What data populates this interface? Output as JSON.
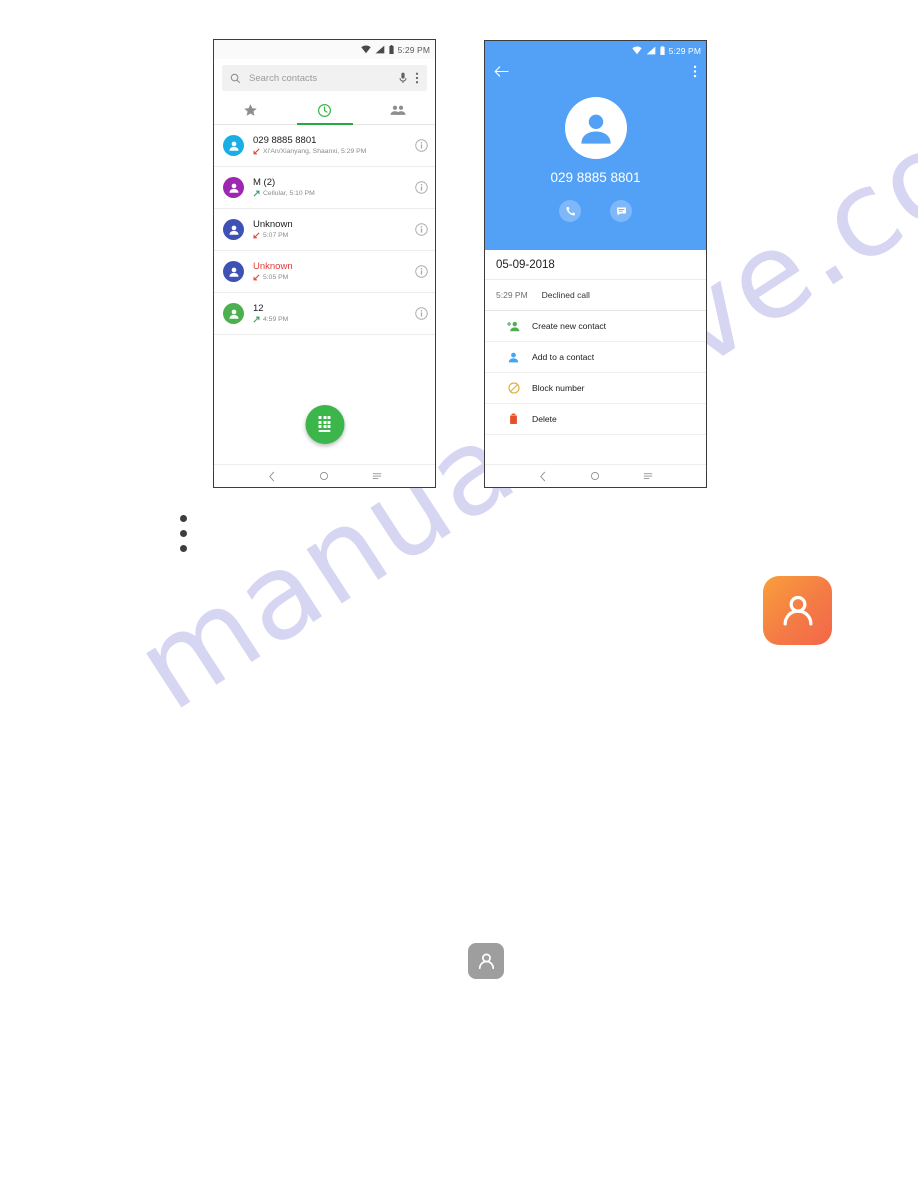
{
  "watermark": {
    "text": "manualshive.com"
  },
  "phone_left": {
    "status_bar": {
      "time": "5:29 PM",
      "icons": [
        "wifi-icon",
        "signal-icon",
        "battery-icon"
      ]
    },
    "search": {
      "placeholder": "Search contacts",
      "search_icon": "search-icon",
      "mic_icon": "microphone-icon",
      "overflow_icon": "overflow-menu-icon"
    },
    "tabs": [
      {
        "name": "favorites",
        "icon": "star-icon",
        "active": false
      },
      {
        "name": "recents",
        "icon": "clock-icon",
        "active": true
      },
      {
        "name": "contacts",
        "icon": "people-icon",
        "active": false
      }
    ],
    "call_log": [
      {
        "name": "029 8885 8801",
        "detail": "Xi'An/Xianyang, Shaanxi, 5:29 PM",
        "direction": "incoming",
        "missed": false,
        "avatar_color": "#1aaee5"
      },
      {
        "name": "M (2)",
        "detail": "Cellular, 5:10 PM",
        "direction": "outgoing",
        "missed": false,
        "avatar_color": "#9c27b0"
      },
      {
        "name": "Unknown",
        "detail": "5:07 PM",
        "direction": "incoming",
        "missed": false,
        "avatar_color": "#3f51b5"
      },
      {
        "name": "Unknown",
        "detail": "5:05 PM",
        "direction": "incoming",
        "missed": true,
        "avatar_color": "#3f51b5"
      },
      {
        "name": "12",
        "detail": "4:59 PM",
        "direction": "outgoing",
        "missed": false,
        "avatar_color": "#4caf50"
      }
    ],
    "fab": {
      "name": "dialpad-fab",
      "color": "#3cb54a"
    },
    "nav": [
      "back-icon",
      "home-icon",
      "recents-icon"
    ]
  },
  "phone_right": {
    "status_bar": {
      "time": "5:29 PM",
      "icons": [
        "wifi-icon",
        "signal-icon",
        "battery-icon"
      ]
    },
    "header": {
      "back_icon": "back-arrow-icon",
      "overflow_icon": "overflow-menu-icon",
      "avatar_icon": "person-icon",
      "number": "029 8885 8801",
      "actions": [
        {
          "name": "call-button",
          "icon": "phone-icon"
        },
        {
          "name": "message-button",
          "icon": "message-icon"
        }
      ],
      "bg_color": "#53a0f7"
    },
    "detail": {
      "date": "05-09-2018",
      "entry": {
        "time": "5:29 PM",
        "label": "Declined call"
      }
    },
    "menu": [
      {
        "label": "Create new contact",
        "icon": "person-add-icon",
        "color": "#4caf50"
      },
      {
        "label": "Add to a contact",
        "icon": "person-icon",
        "color": "#42a5f5"
      },
      {
        "label": "Block number",
        "icon": "block-icon",
        "color": "#e0b33c"
      },
      {
        "label": "Delete",
        "icon": "trash-icon",
        "color": "#e8502a"
      }
    ],
    "nav": [
      "back-icon",
      "home-icon",
      "recents-icon"
    ]
  },
  "standalone_icons": [
    {
      "name": "contacts-app-icon-orange",
      "glyph": "person-icon",
      "colors": [
        "#f9a03c",
        "#f2674a"
      ]
    },
    {
      "name": "contacts-app-icon-grey",
      "glyph": "person-icon",
      "colors": [
        "#9e9e9e"
      ]
    }
  ]
}
